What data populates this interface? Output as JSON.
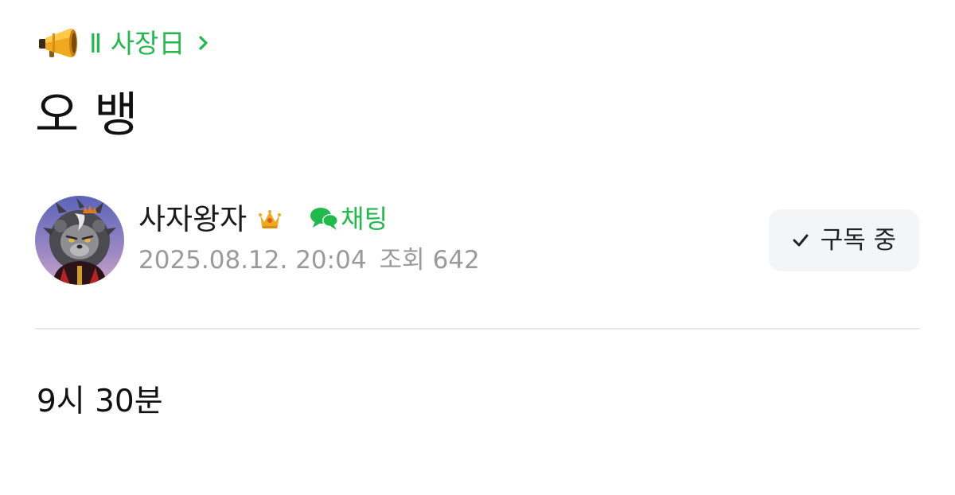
{
  "category": {
    "icon": "megaphone-icon",
    "label": "Ⅱ 사장日",
    "chevron": "chevron-right-icon",
    "color": "#1fb94c"
  },
  "post": {
    "title": "오 뱅",
    "body": "9시 30분"
  },
  "author": {
    "name": "사자왕자",
    "badge_icon": "crown-icon",
    "chat_label": "채팅",
    "chat_icon": "chat-bubbles-icon",
    "date": "2025.08.12. 20:04",
    "views_label": "조회",
    "views_count": "642"
  },
  "subscribe": {
    "label": "구독 중",
    "icon": "check-icon",
    "background": "#f4f5f7"
  },
  "colors": {
    "accent": "#1fb94c",
    "meta_text": "#9a9a9a",
    "divider": "#e6e6e6"
  }
}
